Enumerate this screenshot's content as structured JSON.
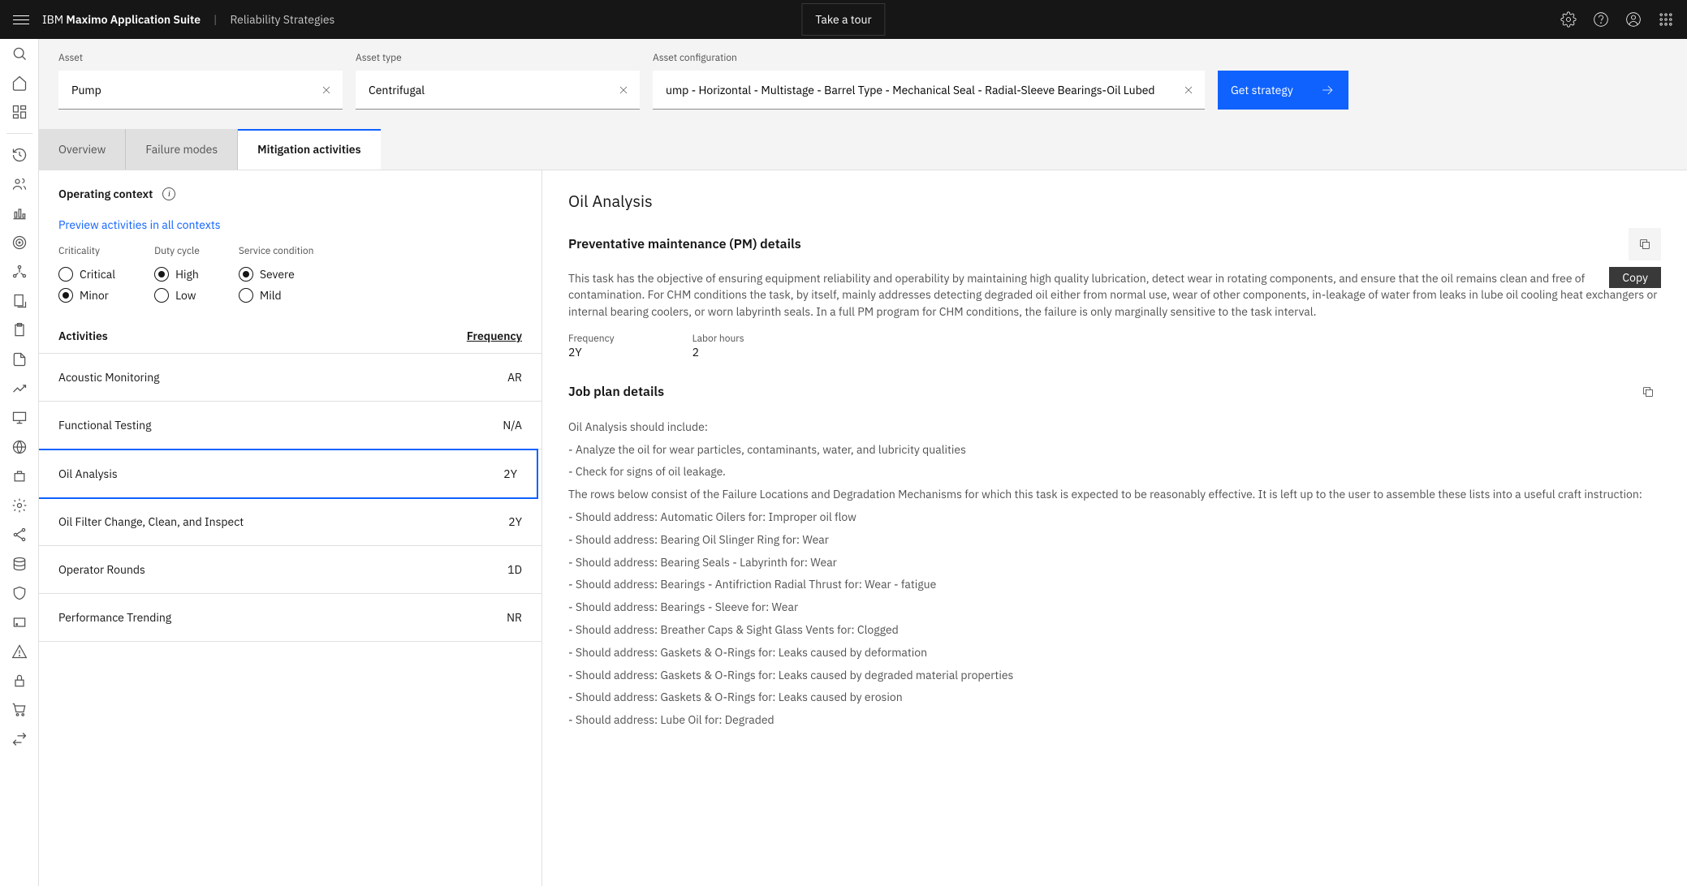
{
  "header": {
    "brand_prefix": "IBM ",
    "brand_bold": "Maximo Application Suite",
    "breadcrumb": "Reliability Strategies",
    "take_tour": "Take a tour"
  },
  "filters": {
    "asset_label": "Asset",
    "asset_value": "Pump",
    "type_label": "Asset type",
    "type_value": "Centrifugal",
    "config_label": "Asset configuration",
    "config_value": "ump - Horizontal - Multistage - Barrel Type - Mechanical Seal - Radial-Sleeve Bearings-Oil Lubed",
    "get_strategy": "Get strategy"
  },
  "tabs": {
    "overview": "Overview",
    "failure": "Failure modes",
    "mitigation": "Mitigation activities"
  },
  "left": {
    "op_context": "Operating context",
    "preview_link": "Preview activities in all contexts",
    "criticality_label": "Criticality",
    "criticality_critical": "Critical",
    "criticality_minor": "Minor",
    "duty_label": "Duty cycle",
    "duty_high": "High",
    "duty_low": "Low",
    "service_label": "Service condition",
    "service_severe": "Severe",
    "service_mild": "Mild",
    "activities_header": "Activities",
    "frequency_header": "Frequency",
    "activities": [
      {
        "name": "Acoustic Monitoring",
        "freq": "AR",
        "selected": false
      },
      {
        "name": "Functional Testing",
        "freq": "N/A",
        "selected": false
      },
      {
        "name": "Oil Analysis",
        "freq": "2Y",
        "selected": true
      },
      {
        "name": "Oil Filter Change, Clean, and Inspect",
        "freq": "2Y",
        "selected": false
      },
      {
        "name": "Operator Rounds",
        "freq": "1D",
        "selected": false
      },
      {
        "name": "Performance Trending",
        "freq": "NR",
        "selected": false
      }
    ]
  },
  "right": {
    "title": "Oil Analysis",
    "pm_heading": "Preventative maintenance (PM) details",
    "copy_tooltip": "Copy",
    "pm_desc": "This task has the objective of ensuring equipment reliability and operability by maintaining high quality lubrication, detect wear in rotating components, and ensure that the oil remains clean and free of contamination. For CHM conditions the task, by itself, mainly addresses detecting degraded oil either from normal use, wear of other components, in-leakage of water from leaks in lube oil cooling heat exchangers or internal bearing coolers, or worn labyrinth seals. In a full PM program for CHM conditions, the failure is only marginally sensitive to the task interval.",
    "freq_label": "Frequency",
    "freq_value": "2Y",
    "labor_label": "Labor hours",
    "labor_value": "2",
    "job_heading": "Job plan details",
    "job_lines": [
      "Oil Analysis should include:",
      "- Analyze the oil for wear particles, contaminants, water, and lubricity qualities",
      "- Check for signs of oil leakage.",
      "The rows below consist of the Failure Locations and Degradation Mechanisms for which this task is expected to be reasonably effective. It is left up to the user to assemble these lists into a useful craft instruction:",
      "- Should address: Automatic Oilers for: Improper oil flow",
      "- Should address: Bearing Oil Slinger Ring for: Wear",
      "- Should address: Bearing Seals - Labyrinth for: Wear",
      "- Should address: Bearings - Antifriction Radial Thrust for: Wear - fatigue",
      "- Should address: Bearings - Sleeve for: Wear",
      "- Should address: Breather Caps & Sight Glass Vents for: Clogged",
      "- Should address: Gaskets & O-Rings for: Leaks caused by deformation",
      "- Should address: Gaskets & O-Rings for: Leaks caused by degraded material properties",
      "- Should address: Gaskets & O-Rings for: Leaks caused by erosion",
      "- Should address: Lube Oil for: Degraded"
    ]
  }
}
